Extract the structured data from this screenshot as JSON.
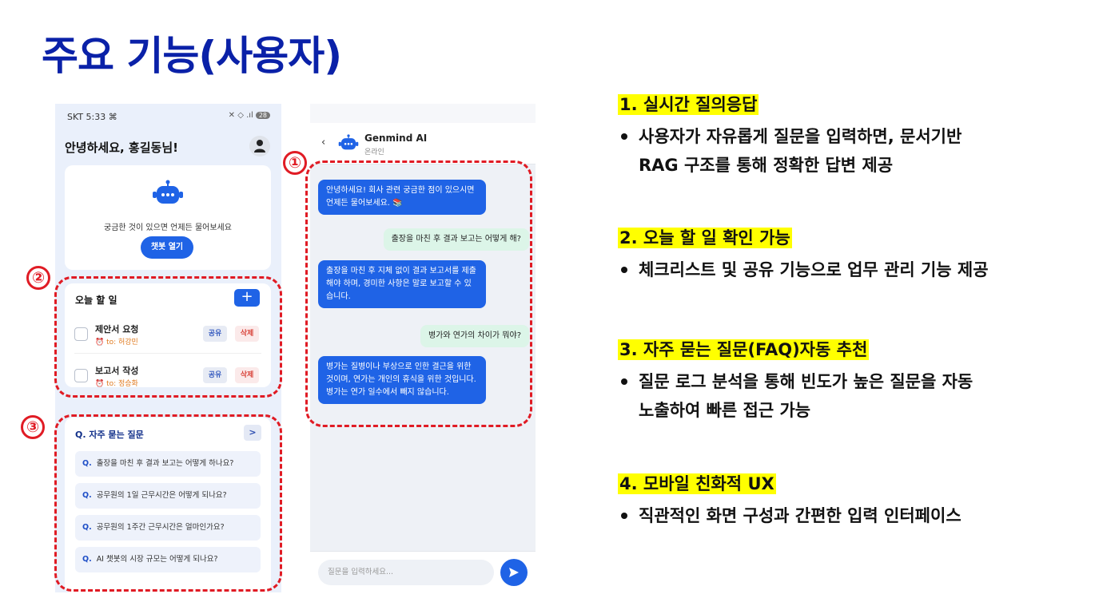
{
  "slide": {
    "title": "주요 기능(사용자)"
  },
  "phone1": {
    "status_left": "SKT 5:33 ⌘",
    "status_right": "✕ ◇ .ıl",
    "battery": "28",
    "greeting": "안녕하세요, 홍길동님!",
    "bot_prompt": "궁금한 것이 있으면 언제든 물어보세요",
    "bot_button": "챗봇 열기",
    "todo": {
      "title": "오늘 할 일",
      "add_label": "+",
      "items": [
        {
          "name": "제안서 요청",
          "to": "⏰ to: 허강민",
          "share": "공유",
          "delete": "삭제"
        },
        {
          "name": "보고서 작성",
          "to": "⏰ to: 정승화",
          "share": "공유",
          "delete": "삭제"
        }
      ]
    },
    "faq": {
      "title": "Q. 자주 묻는 질문",
      "more": ">",
      "items": [
        {
          "q": "Q.",
          "text": "출장을 마친 후 결과 보고는 어떻게 하나요?"
        },
        {
          "q": "Q.",
          "text": "공무원의 1일 근무시간은 어떻게 되나요?"
        },
        {
          "q": "Q.",
          "text": "공무원의 1주간 근무시간은 얼마인가요?"
        },
        {
          "q": "Q.",
          "text": "AI 챗봇의 시장 규모는 어떻게 되나요?"
        }
      ]
    }
  },
  "phone2": {
    "back": "‹",
    "bot_name": "Genmind AI",
    "bot_status": "온라인",
    "messages": [
      {
        "role": "bot",
        "text": "안녕하세요! 회사 관련 궁금한 점이 있으시면 언제든 물어보세요. 📚"
      },
      {
        "role": "user",
        "text": "출장을 마친 후 결과 보고는 어떻게 해?"
      },
      {
        "role": "bot",
        "text": "출장을 마친 후 지체 없이 결과 보고서를 제출해야 하며, 경미한 사항은 말로 보고할 수 있습니다."
      },
      {
        "role": "user",
        "text": "병가와 연가의 차이가 뭐야?"
      },
      {
        "role": "bot",
        "text": "병가는 질병이나 부상으로 인한 결근을 위한 것이며, 연가는 개인의 휴식을 위한 것입니다. 병가는 연가 일수에서 빼지 않습니다."
      }
    ],
    "input_placeholder": "질문을 입력하세요..."
  },
  "annotations": {
    "one": "①",
    "two": "②",
    "three": "③"
  },
  "features": [
    {
      "title": "1. 실시간 질의응답",
      "body": [
        "사용자가 자유롭게 질문을 입력하면, 문서기반",
        "RAG 구조를 통해 정확한 답변 제공"
      ]
    },
    {
      "title": "2. 오늘 할 일 확인 가능",
      "body": [
        "체크리스트 및 공유 기능으로 업무 관리 기능 제공"
      ]
    },
    {
      "title": "3. 자주 묻는 질문(FAQ)자동 추천",
      "body": [
        "질문 로그 분석을 통해 빈도가 높은 질문을 자동",
        "노출하여 빠른 접근 가능"
      ]
    },
    {
      "title": "4. 모바일 친화적 UX",
      "body": [
        "직관적인 화면 구성과 간편한 입력 인터페이스"
      ]
    }
  ],
  "colors": {
    "title": "#0a21a8",
    "accent": "#1f63e6",
    "annotation": "#e01b24",
    "highlight": "#ffff00"
  }
}
